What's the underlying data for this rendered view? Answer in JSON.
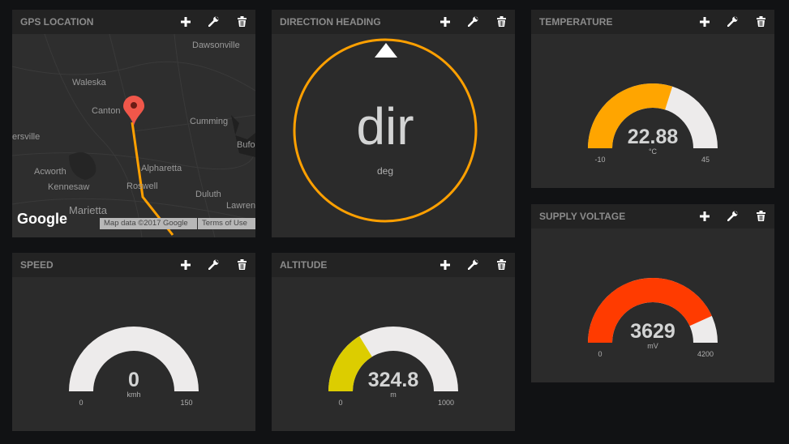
{
  "panels": {
    "gps": {
      "title": "GPS LOCATION",
      "map": {
        "places": [
          "Dawsonville",
          "Waleska",
          "Canton",
          "Cumming",
          "ersville",
          "Bufo",
          "Acworth",
          "Alpharetta",
          "Kennesaw",
          "Roswell",
          "Duluth",
          "Marietta",
          "Lawren"
        ],
        "logo": "Google",
        "attribution": "Map data ©2017 Google",
        "terms": "Terms of Use",
        "marker_color": "#f0574a",
        "track_color": "#ffa000"
      }
    },
    "direction": {
      "title": "DIRECTION HEADING",
      "value": "dir",
      "unit": "deg",
      "ring_color": "#ffa000"
    },
    "temperature": {
      "title": "TEMPERATURE",
      "value": "22.88",
      "numeric": 22.88,
      "unit": "°C",
      "min": "-10",
      "max": "45",
      "color": "#ffa500"
    },
    "voltage": {
      "title": "SUPPLY VOLTAGE",
      "value": "3629",
      "numeric": 3629,
      "unit": "mV",
      "min": "0",
      "max": "4200",
      "color": "#ff3b00"
    },
    "speed": {
      "title": "SPEED",
      "value": "0",
      "numeric": 0,
      "unit": "kmh",
      "min": "0",
      "max": "150",
      "color": "#ffa500"
    },
    "altitude": {
      "title": "ALTITUDE",
      "value": "324.8",
      "numeric": 324.8,
      "unit": "m",
      "min": "0",
      "max": "1000",
      "color": "#dccd00"
    }
  },
  "icons": {
    "add": "plus-icon",
    "settings": "wrench-icon",
    "delete": "trash-icon"
  },
  "gauge_track_color": "#edebeb"
}
